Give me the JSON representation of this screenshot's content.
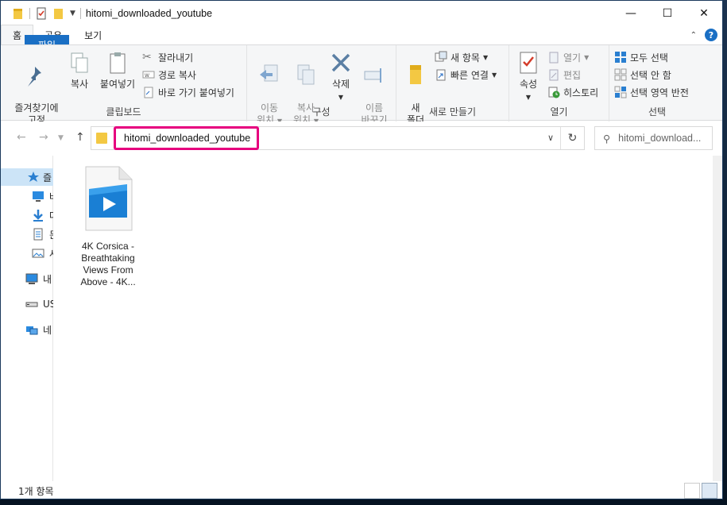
{
  "window": {
    "title": "hitomi_downloaded_youtube"
  },
  "tabs": [
    {
      "label": "파일"
    },
    {
      "label": "홈"
    },
    {
      "label": "공유"
    },
    {
      "label": "보기"
    }
  ],
  "ribbon": {
    "clipboard": {
      "group_label": "클립보드",
      "pin_label": "즐겨찾기에\n고정",
      "copy_label": "복사",
      "paste_label": "붙여넣기",
      "cut_label": "잘라내기",
      "copy_path_label": "경로 복사",
      "paste_shortcut_label": "바로 가기 붙여넣기"
    },
    "organize": {
      "group_label": "구성",
      "move_to_label": "이동\n위치",
      "copy_to_label": "복사\n위치",
      "delete_label": "삭제",
      "rename_label": "이름\n바꾸기"
    },
    "new": {
      "group_label": "새로 만들기",
      "new_folder_label": "새\n폴더",
      "new_item_label": "새 항목",
      "easy_access_label": "빠른 연결"
    },
    "open": {
      "group_label": "열기",
      "properties_label": "속성",
      "open_label": "열기",
      "edit_label": "편집",
      "history_label": "히스토리"
    },
    "select": {
      "group_label": "선택",
      "select_all_label": "모두 선택",
      "select_none_label": "선택 안 함",
      "invert_label": "선택 영역 반전"
    }
  },
  "address": {
    "path": "hitomi_downloaded_youtube"
  },
  "search": {
    "placeholder": "hitomi_download..."
  },
  "navpane": {
    "items": [
      {
        "label": "즐",
        "icon": "star-icon"
      },
      {
        "label": "바",
        "icon": "desktop-icon"
      },
      {
        "label": "다",
        "icon": "download-icon"
      },
      {
        "label": "문",
        "icon": "document-icon"
      },
      {
        "label": "사",
        "icon": "pictures-icon"
      },
      {
        "label": "내",
        "icon": "pc-icon"
      },
      {
        "label": "US",
        "icon": "usb-drive-icon"
      },
      {
        "label": "네",
        "icon": "network-icon"
      }
    ]
  },
  "files": [
    {
      "name": "4K Corsica -\nBreathtaking\nViews From\nAbove - 4K..."
    }
  ],
  "status": {
    "item_count": "1개 항목"
  },
  "colors": {
    "accent": "#1a6fc4",
    "highlight_box": "#e6007e",
    "folder": "#f3c843"
  }
}
